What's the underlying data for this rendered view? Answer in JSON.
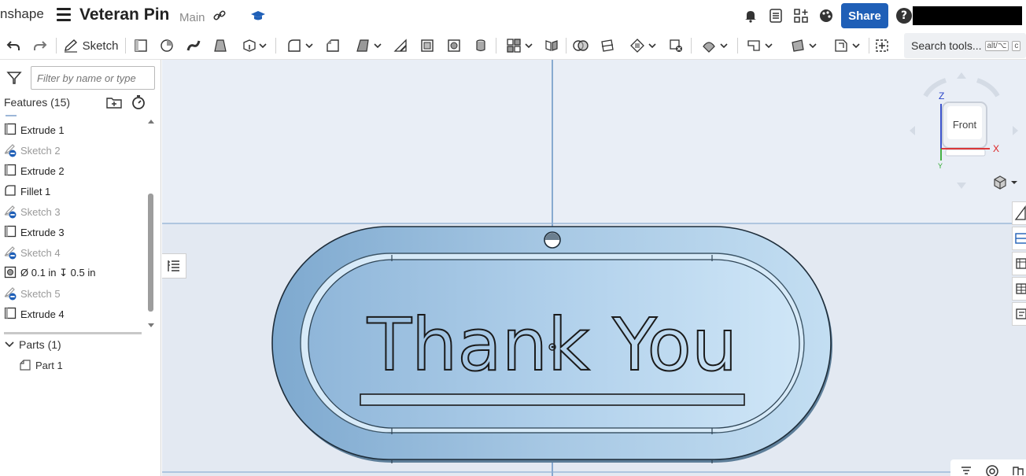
{
  "app": {
    "logo_text": "nshape",
    "document_title": "Veteran Pin",
    "workspace": "Main"
  },
  "header": {
    "share_label": "Share",
    "help_symbol": "?"
  },
  "toolbar": {
    "sketch_label": "Sketch",
    "search_label": "Search tools...",
    "search_shortcut_1": "alt/⌥",
    "search_shortcut_2": "c"
  },
  "sidebar": {
    "filter_placeholder": "Filter by name or type",
    "features_header": "Features (15)",
    "features": [
      {
        "label": "Extrude 1",
        "icon": "extrude-icon",
        "suppressed": false
      },
      {
        "label": "Sketch 2",
        "icon": "sketch-icon",
        "suppressed": true
      },
      {
        "label": "Extrude 2",
        "icon": "extrude-icon",
        "suppressed": false
      },
      {
        "label": "Fillet 1",
        "icon": "fillet-icon",
        "suppressed": false
      },
      {
        "label": "Sketch 3",
        "icon": "sketch-icon",
        "suppressed": true
      },
      {
        "label": "Extrude 3",
        "icon": "extrude-icon",
        "suppressed": false
      },
      {
        "label": "Sketch 4",
        "icon": "sketch-icon",
        "suppressed": true
      },
      {
        "label": "Ø 0.1 in ↧ 0.5 in",
        "icon": "hole-icon",
        "suppressed": false
      },
      {
        "label": "Sketch 5",
        "icon": "sketch-icon",
        "suppressed": true
      },
      {
        "label": "Extrude 4",
        "icon": "extrude-icon",
        "suppressed": false
      }
    ],
    "parts_header": "Parts (1)",
    "parts": [
      {
        "label": "Part 1"
      }
    ]
  },
  "viewport": {
    "model_text": "Thank You",
    "view_cube_label": "Front",
    "axis_x": "X",
    "axis_y": "Y",
    "axis_z": "Z"
  },
  "colors": {
    "share": "#1f5fb7",
    "part": "#a9cbe8",
    "viewport_bg": "#e8eef6"
  }
}
